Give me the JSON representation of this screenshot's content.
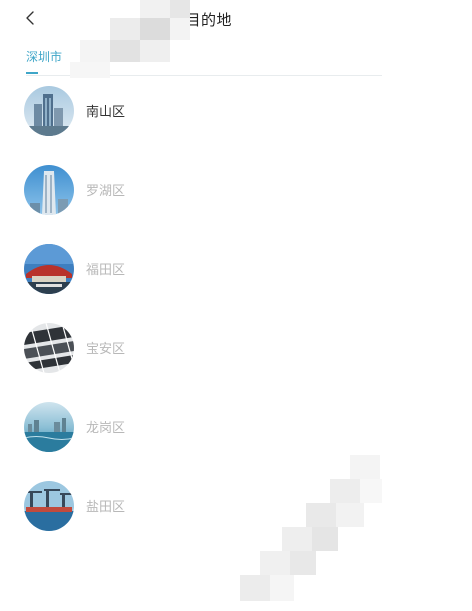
{
  "header": {
    "title": "择目的地",
    "back_icon": "chevron-left-icon"
  },
  "tabs": [
    {
      "label": "深圳市",
      "selected": true
    }
  ],
  "districts": [
    {
      "label": "南山区",
      "active": true,
      "image": "skyscraper-photo"
    },
    {
      "label": "罗湖区",
      "active": false,
      "image": "tower-photo"
    },
    {
      "label": "福田区",
      "active": false,
      "image": "civic-center-photo"
    },
    {
      "label": "宝安区",
      "active": false,
      "image": "airport-roof-photo"
    },
    {
      "label": "龙岗区",
      "active": false,
      "image": "waterfront-photo"
    },
    {
      "label": "盐田区",
      "active": false,
      "image": "port-cranes-photo"
    }
  ],
  "colors": {
    "accent": "#3fa6c8",
    "active_text": "#333333",
    "inactive_text": "#b8b8b8"
  }
}
